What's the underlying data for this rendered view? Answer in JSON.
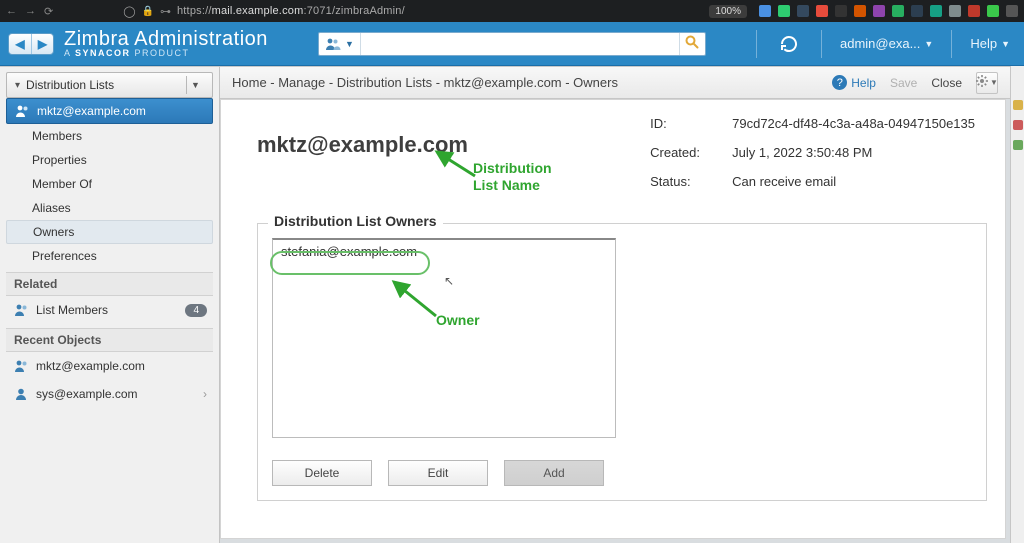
{
  "browser": {
    "url_prefix": "https://",
    "url_host": "mail.example.com",
    "url_path": ":7071/zimbraAdmin/",
    "zoom": "100%"
  },
  "header": {
    "brand_title": "Zimbra Administration",
    "brand_sub_a": "A ",
    "brand_sub_b": "SYNACOR",
    "brand_sub_c": " PRODUCT",
    "search_placeholder": "",
    "user_label": "admin@exa...",
    "help_label": "Help"
  },
  "sidebar": {
    "header_label": "Distribution Lists",
    "selected_label": "mktz@example.com",
    "items": [
      {
        "label": "Members"
      },
      {
        "label": "Properties"
      },
      {
        "label": "Member Of"
      },
      {
        "label": "Aliases"
      },
      {
        "label": "Owners"
      },
      {
        "label": "Preferences"
      }
    ],
    "related_label": "Related",
    "list_members_label": "List Members",
    "list_members_count": "4",
    "recent_label": "Recent Objects",
    "recent": [
      {
        "label": "mktz@example.com"
      },
      {
        "label": "sys@example.com"
      }
    ]
  },
  "toolbar": {
    "breadcrumb": "Home - Manage - Distribution Lists - mktz@example.com - Owners",
    "help_label": "Help",
    "save_label": "Save",
    "close_label": "Close"
  },
  "main": {
    "dl_name": "mktz@example.com",
    "info": {
      "id_key": "ID:",
      "id_val": "79cd72c4-df48-4c3a-a48a-04947150e135",
      "created_key": "Created:",
      "created_val": "July 1, 2022 3:50:48 PM",
      "status_key": "Status:",
      "status_val": "Can receive email"
    },
    "fieldset_title": "Distribution List Owners",
    "owners": [
      {
        "email": "stefania@example.com"
      }
    ],
    "buttons": {
      "delete": "Delete",
      "edit": "Edit",
      "add": "Add"
    },
    "annot_dlname": "Distribution\nList Name",
    "annot_owner": "Owner"
  }
}
